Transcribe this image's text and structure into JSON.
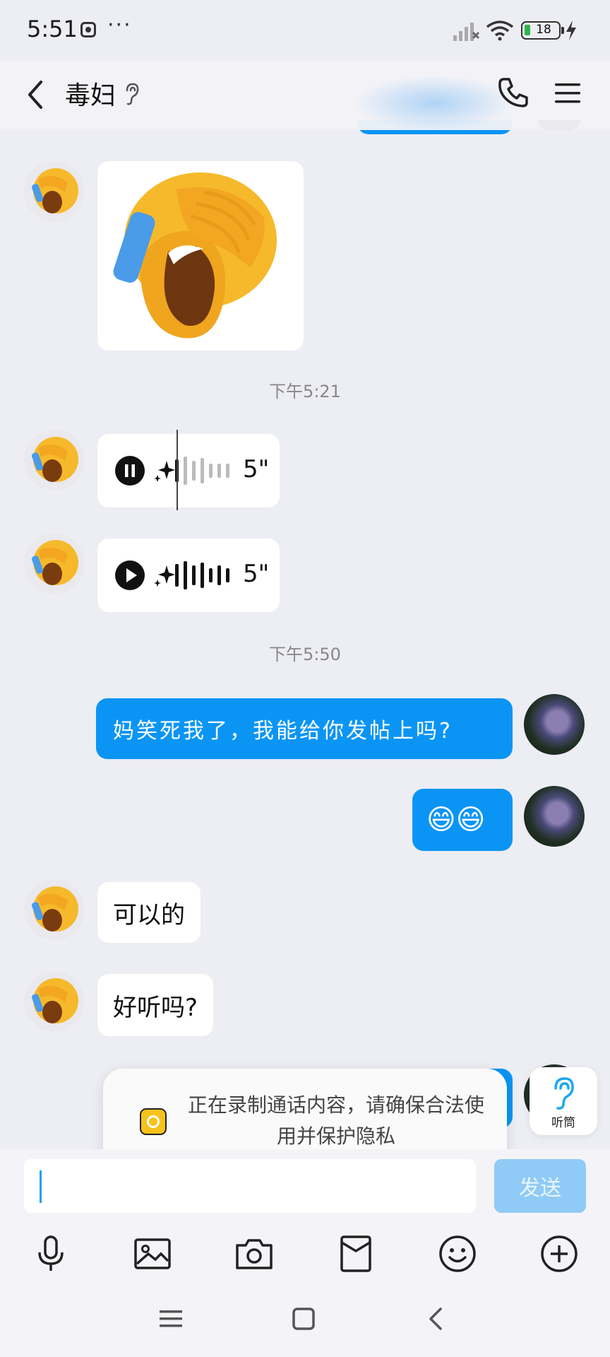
{
  "status_bar": {
    "time": "5:51",
    "dots": "···",
    "battery": "18"
  },
  "header": {
    "title": "毒妇"
  },
  "messages": {
    "timestamp_1": "下午5:21",
    "voice_1_duration": "5\"",
    "voice_2_duration": "5\"",
    "timestamp_2": "下午5:50",
    "sent_1": "妈笑死我了，我能给你发帖上吗?",
    "sent_2": "😄😄",
    "recv_1": "可以的",
    "recv_2": "好听吗?"
  },
  "toast": {
    "text": "正在录制通话内容，请确保合法使用并保护隐私"
  },
  "earpiece": {
    "label": "听筒"
  },
  "composer": {
    "send_label": "发送",
    "value": ""
  },
  "colors": {
    "accent": "#0a95f5",
    "background": "#ededf4",
    "send_disabled": "#8fcbf6"
  },
  "icons": [
    "back-icon",
    "hear-icon",
    "phone-icon",
    "menu-icon",
    "mic-icon",
    "image-icon",
    "camera-icon",
    "red-packet-icon",
    "emoji-icon",
    "plus-icon"
  ]
}
